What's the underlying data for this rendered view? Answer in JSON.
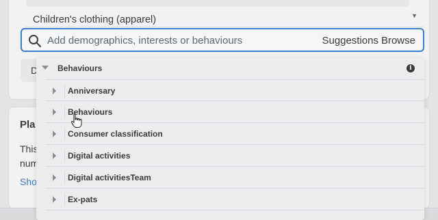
{
  "field_value": "Children's clothing (apparel)",
  "search": {
    "placeholder": "Add demographics, interests or behaviours",
    "suggestions_label": "Suggestions",
    "browse_label": "Browse"
  },
  "dropdown": {
    "header": "Behaviours",
    "items": [
      {
        "label": "Anniversary"
      },
      {
        "label": "Behaviours"
      },
      {
        "label": "Consumer classification"
      },
      {
        "label": "Digital activities"
      },
      {
        "label": "Digital activitiesTeam"
      },
      {
        "label": "Ex-pats"
      }
    ]
  },
  "background_fragments": {
    "tab_letter": "D",
    "section_title": "Pla",
    "text_line_1": "This",
    "text_line_2": "num",
    "link": "Sho"
  },
  "colors": {
    "accent": "#3d7bd1"
  }
}
